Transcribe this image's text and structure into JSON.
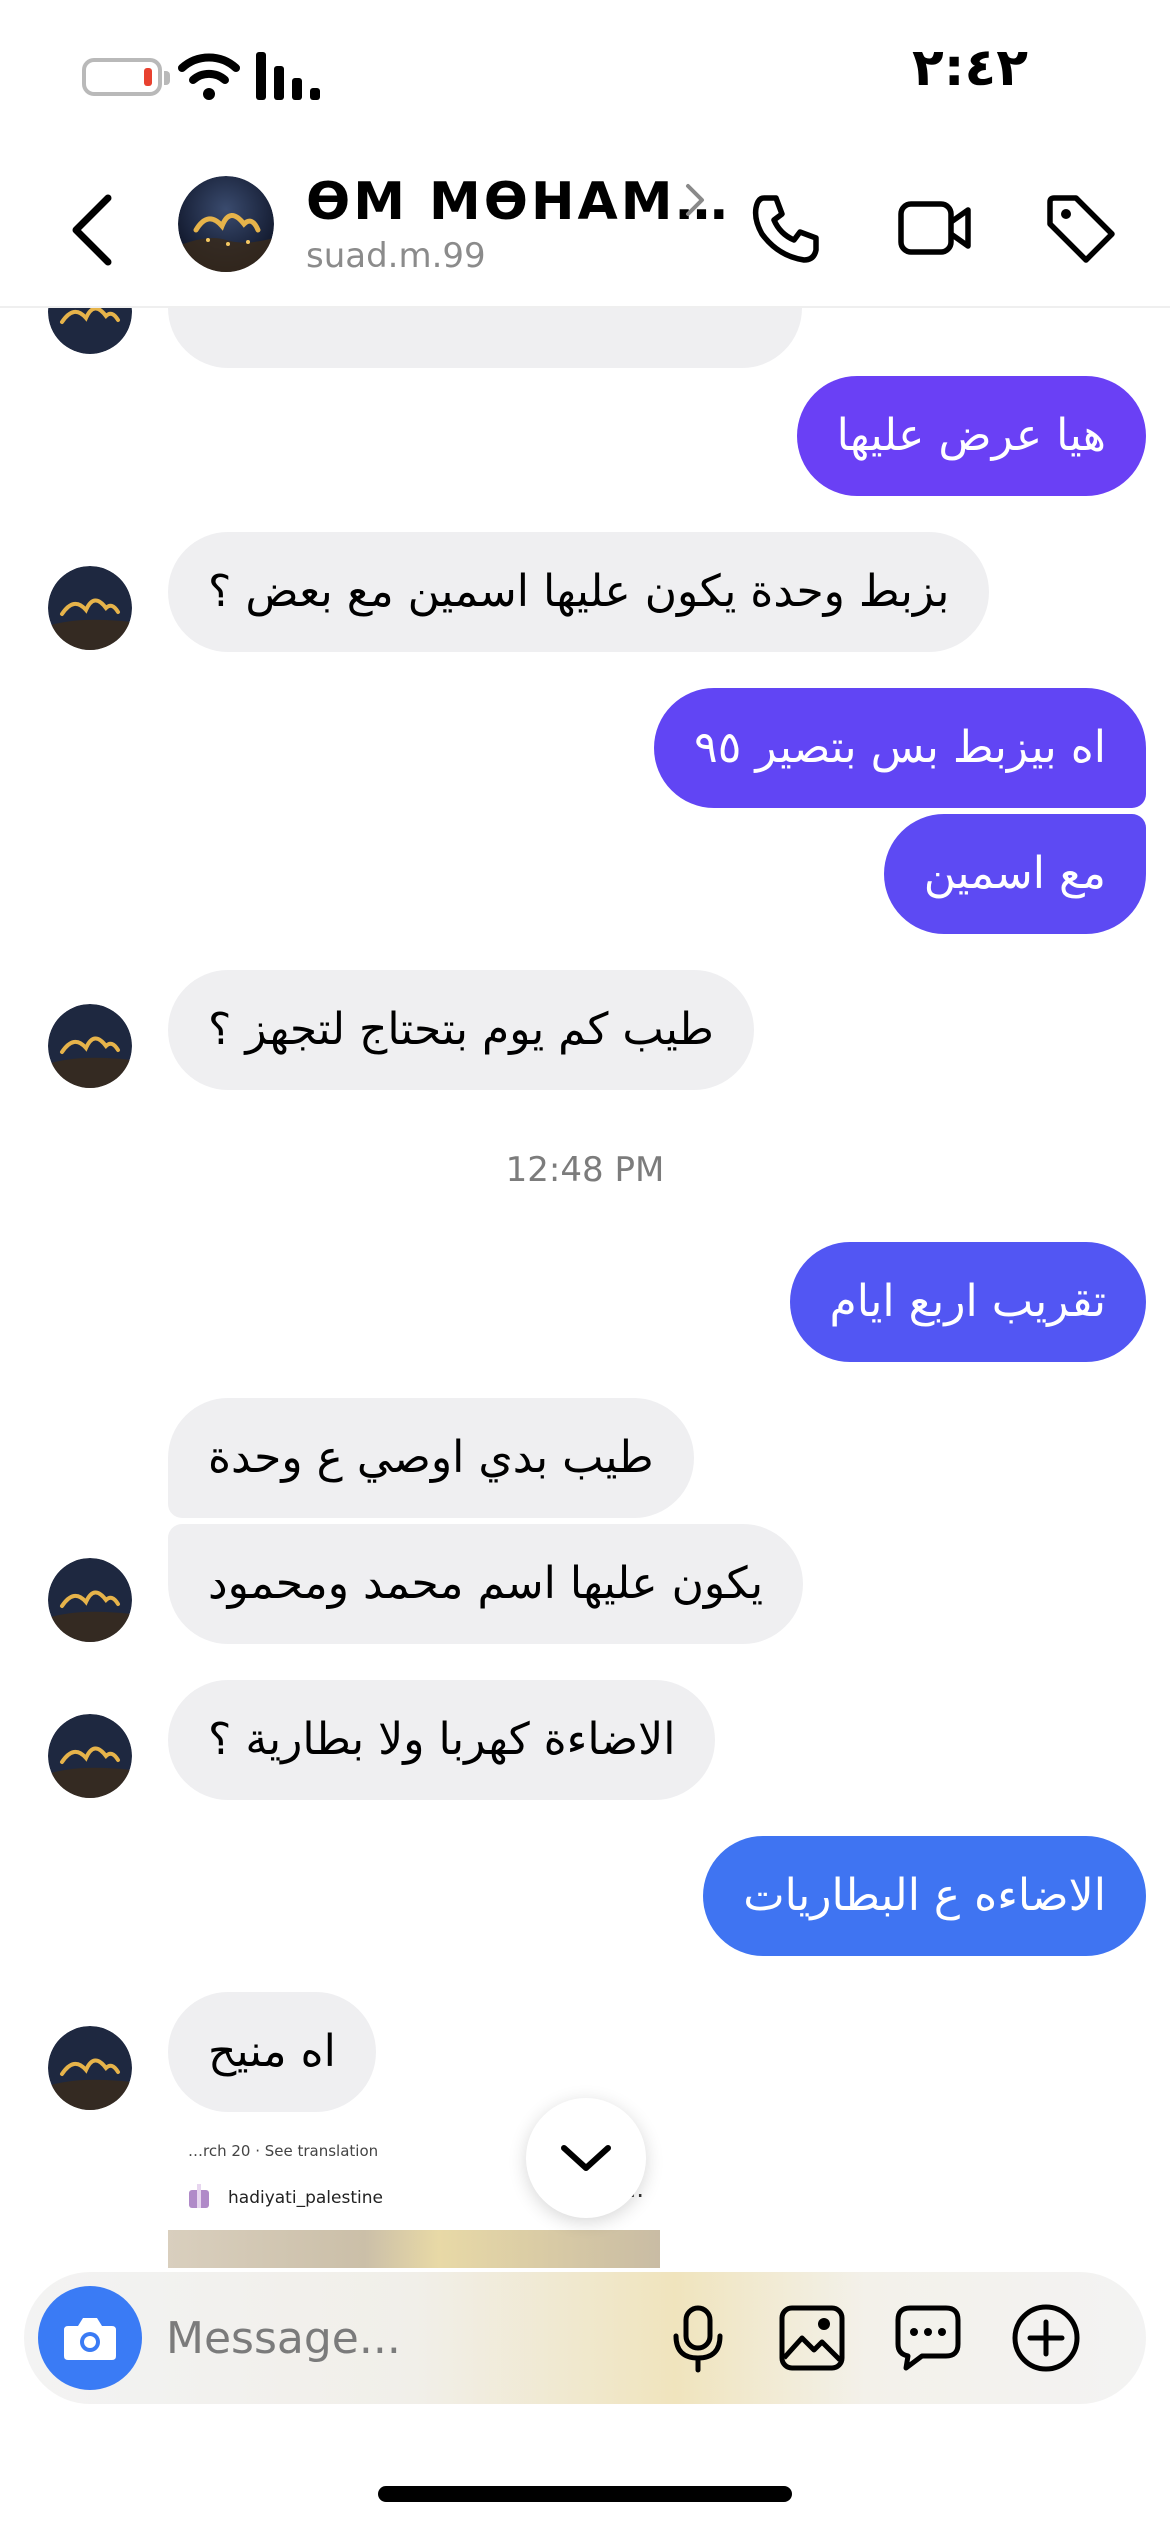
{
  "status_bar": {
    "time": "٢:٤٢"
  },
  "header": {
    "contact_name": "ƟM MƟHAM…",
    "contact_handle": "suad.m.99"
  },
  "messages": [
    {
      "direction": "out",
      "text": "هيا عرض عليها",
      "color": "#6a40f5"
    },
    {
      "direction": "in",
      "text": "بزبط وحدة يكون عليها اسمين مع بعض ؟"
    },
    {
      "direction": "out",
      "text": "اه بيزبط بس بتصير ٩٥",
      "color": "#6145f4"
    },
    {
      "direction": "out",
      "text": "مع اسمين",
      "color": "#5d4af3"
    },
    {
      "direction": "in",
      "text": "طيب كم يوم بتحتاج لتجهز ؟"
    },
    {
      "direction": "out",
      "text": "تقريب اربع ايام",
      "color": "#5256f3"
    },
    {
      "direction": "in",
      "text": "طيب بدي اوصي ع وحدة"
    },
    {
      "direction": "in",
      "text": "يكون عليها اسم محمد ومحمود"
    },
    {
      "direction": "in",
      "text": "الاضاءة كهربا  ولا بطارية ؟"
    },
    {
      "direction": "out",
      "text": "الاضاءه  ع البطاريات",
      "color": "#3f74f2"
    },
    {
      "direction": "in",
      "text": "اه منيح"
    }
  ],
  "timestamp": "12:48 PM",
  "shared_post": {
    "meta": "…rch 20 · See translation",
    "username": "hadiyati_palestine",
    "more": "···"
  },
  "composer": {
    "placeholder": "Message..."
  },
  "icons": {
    "back": "chevron-left-icon",
    "call": "phone-icon",
    "video": "video-camera-icon",
    "tag": "tag-icon",
    "camera": "camera-icon",
    "mic": "microphone-icon",
    "gallery": "image-icon",
    "sticker": "chat-bubble-icon",
    "add": "plus-circle-icon",
    "scroll_down": "chevron-down-icon"
  }
}
